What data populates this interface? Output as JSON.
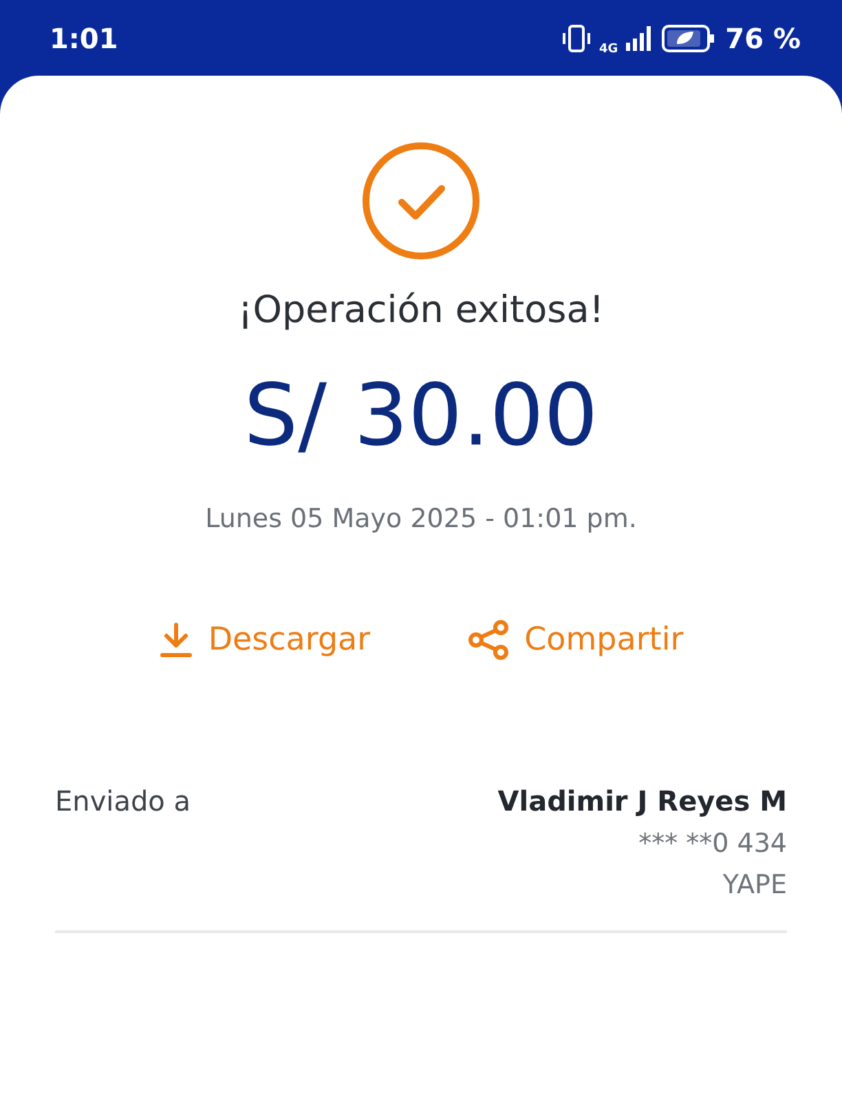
{
  "status_bar": {
    "time": "1:01",
    "network": "4G",
    "battery": "76 %"
  },
  "title": "¡Operación exitosa!",
  "amount": "S/ 30.00",
  "date": "Lunes 05 Mayo 2025 - 01:01 pm.",
  "actions": [
    {
      "kind": "download",
      "label": "Descargar"
    },
    {
      "kind": "share",
      "label": "Compartir"
    }
  ],
  "details": [
    {
      "label": "Enviado a",
      "values": [
        "Vladimir J Reyes M",
        "*** **0 434",
        "YAPE"
      ]
    }
  ]
}
